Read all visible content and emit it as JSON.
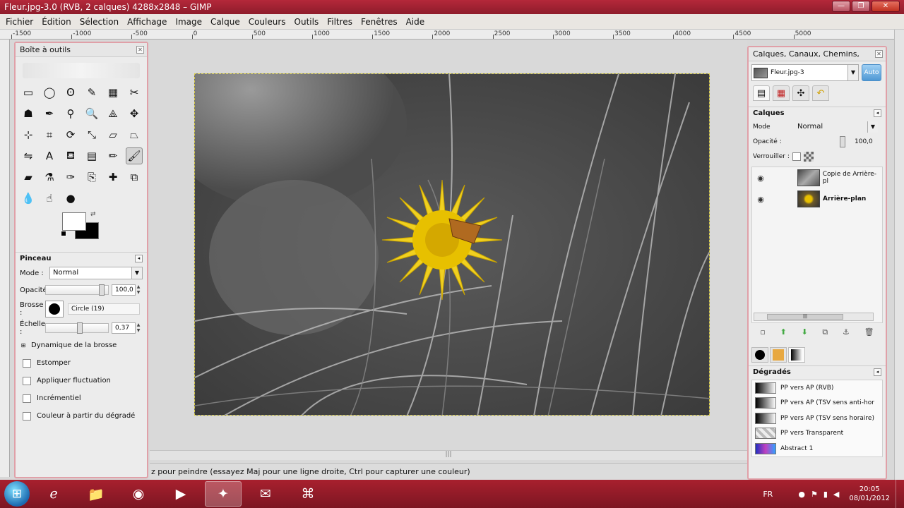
{
  "window": {
    "title": "Fleur.jpg-3.0 (RVB, 2 calques) 4288x2848 – GIMP",
    "controls": {
      "minimize": "—",
      "maximize": "❐",
      "close": "✕"
    }
  },
  "menu": [
    "Fichier",
    "Édition",
    "Sélection",
    "Affichage",
    "Image",
    "Calque",
    "Couleurs",
    "Outils",
    "Filtres",
    "Fenêtres",
    "Aide"
  ],
  "ruler_labels": [
    "-1500",
    "-1000",
    "-500",
    "0",
    "500",
    "1000",
    "1500",
    "2000",
    "2500",
    "3000",
    "3500",
    "4000",
    "4500",
    "5000"
  ],
  "toolbox": {
    "title": "Boîte à outils",
    "tools": [
      {
        "name": "rect-select-tool-icon",
        "glyph": "▭"
      },
      {
        "name": "ellipse-select-tool-icon",
        "glyph": "◯"
      },
      {
        "name": "free-select-tool-icon",
        "glyph": "ʘ"
      },
      {
        "name": "fuzzy-select-tool-icon",
        "glyph": "✎"
      },
      {
        "name": "select-by-color-tool-icon",
        "glyph": "▦"
      },
      {
        "name": "scissors-tool-icon",
        "glyph": "✂"
      },
      {
        "name": "foreground-select-tool-icon",
        "glyph": "☗"
      },
      {
        "name": "paths-tool-icon",
        "glyph": "✒"
      },
      {
        "name": "color-picker-tool-icon",
        "glyph": "⚲"
      },
      {
        "name": "zoom-tool-icon",
        "glyph": "🔍"
      },
      {
        "name": "measure-tool-icon",
        "glyph": "⟁"
      },
      {
        "name": "move-tool-icon",
        "glyph": "✥"
      },
      {
        "name": "align-tool-icon",
        "glyph": "⊹"
      },
      {
        "name": "crop-tool-icon",
        "glyph": "⌗"
      },
      {
        "name": "rotate-tool-icon",
        "glyph": "⟳"
      },
      {
        "name": "scale-tool-icon",
        "glyph": "⤡"
      },
      {
        "name": "shear-tool-icon",
        "glyph": "▱"
      },
      {
        "name": "perspective-tool-icon",
        "glyph": "⏢"
      },
      {
        "name": "flip-tool-icon",
        "glyph": "⇋"
      },
      {
        "name": "text-tool-icon",
        "glyph": "A"
      },
      {
        "name": "bucket-fill-tool-icon",
        "glyph": "⛾"
      },
      {
        "name": "blend-tool-icon",
        "glyph": "▤"
      },
      {
        "name": "pencil-tool-icon",
        "glyph": "✏"
      },
      {
        "name": "paintbrush-tool-icon",
        "glyph": "🖌"
      },
      {
        "name": "eraser-tool-icon",
        "glyph": "▰"
      },
      {
        "name": "airbrush-tool-icon",
        "glyph": "⚗"
      },
      {
        "name": "ink-tool-icon",
        "glyph": "✑"
      },
      {
        "name": "clone-tool-icon",
        "glyph": "⎘"
      },
      {
        "name": "heal-tool-icon",
        "glyph": "✚"
      },
      {
        "name": "perspective-clone-tool-icon",
        "glyph": "⧉"
      },
      {
        "name": "blur-tool-icon",
        "glyph": "💧"
      },
      {
        "name": "smudge-tool-icon",
        "glyph": "☝"
      },
      {
        "name": "dodge-burn-tool-icon",
        "glyph": "●"
      }
    ],
    "active_tool": 23,
    "options_title": "Pinceau",
    "mode_label": "Mode :",
    "mode_value": "Normal",
    "opacity_label": "Opacité",
    "opacity_value": "100,0",
    "opacity_fraction": 0.94,
    "brush_label": "Brosse :",
    "brush_name": "Circle (19)",
    "scale_label": "Échelle :",
    "scale_value": "0,37",
    "scale_fraction": 0.55,
    "dynamics_label": "Dynamique de la brosse",
    "checks": [
      "Estomper",
      "Appliquer fluctuation",
      "Incrémentiel",
      "Couleur à partir du dégradé"
    ]
  },
  "status": "z pour peindre (essayez Maj pour une ligne droite, Ctrl pour capturer une couleur)",
  "right_dock": {
    "title": "Calques, Canaux, Chemins, Annul...",
    "image_name": "Fleur.jpg-3",
    "auto_label": "Auto",
    "layers_title": "Calques",
    "mode_label": "Mode",
    "mode_value": "Normal",
    "opacity_label": "Opacité :",
    "opacity_value": "100,0",
    "opacity_fraction": 0.92,
    "lock_label": "Verrouiller :",
    "layers": [
      {
        "name": "Copie de Arrière-pl",
        "bold": false
      },
      {
        "name": "Arrière-plan",
        "bold": true
      }
    ],
    "gradients_title": "Dégradés",
    "gradients": [
      {
        "name": "PP vers AP (RVB)",
        "swatch": "linear-gradient(90deg,#000,#fff)"
      },
      {
        "name": "PP vers AP (TSV sens anti-hor",
        "swatch": "linear-gradient(90deg,#000,#fff)"
      },
      {
        "name": "PP vers AP (TSV sens horaire)",
        "swatch": "linear-gradient(90deg,#000,#fff)"
      },
      {
        "name": "PP vers Transparent",
        "swatch": "repeating-linear-gradient(45deg,#bbb 0 4px,#eee 4px 8px)"
      },
      {
        "name": "Abstract 1",
        "swatch": "linear-gradient(90deg,#2030c0,#c040c0,#30a0ff)"
      }
    ]
  },
  "taskbar": {
    "apps": [
      {
        "name": "internet-explorer-icon",
        "glyph": "ℯ"
      },
      {
        "name": "file-explorer-icon",
        "glyph": "📁"
      },
      {
        "name": "firefox-icon",
        "glyph": "◉"
      },
      {
        "name": "media-player-icon",
        "glyph": "▶"
      },
      {
        "name": "gimp-icon",
        "glyph": "✦"
      },
      {
        "name": "notes-icon",
        "glyph": "✉"
      },
      {
        "name": "gimp-alt-icon",
        "glyph": "⌘"
      }
    ],
    "active_app": 4,
    "lang": "FR",
    "time": "20:05",
    "date": "08/01/2012"
  }
}
